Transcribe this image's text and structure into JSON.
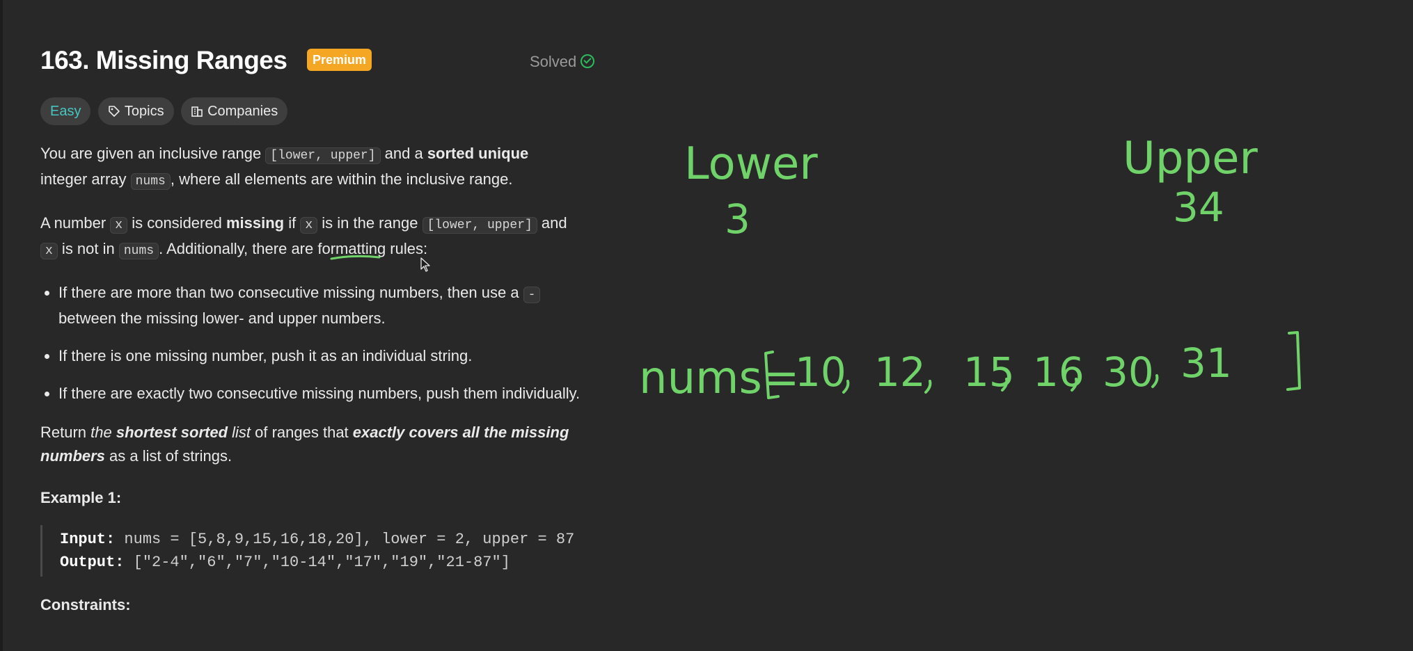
{
  "problem": {
    "title": "163. Missing Ranges",
    "premium_badge": "Premium",
    "status": "Solved",
    "tags": {
      "difficulty": "Easy",
      "topics": "Topics",
      "companies": "Companies"
    }
  },
  "description": {
    "p1": {
      "t1": "You are given an inclusive range ",
      "code1": "[lower, upper]",
      "t2": " and a ",
      "bold1": "sorted unique",
      "t3": " integer array ",
      "code2": "nums",
      "t4": ", where all elements are within the inclusive range."
    },
    "p2": {
      "t1": "A number ",
      "code1": "x",
      "t2": " is considered ",
      "bold1": "missing",
      "t3": " if ",
      "code2": "x",
      "t4": " is in the range ",
      "code3": "[lower, upper]",
      "t5": " and ",
      "code4": "x",
      "t6": " is not in ",
      "code5": "nums",
      "t7": ". Additionally, there are formatting rules:"
    },
    "rules": {
      "r1_text": "If there are more than two consecutive missing numbers, then use a ",
      "r1_code": "-",
      "r1_tail": " between the missing lower- and upper numbers.",
      "r2": "If there is one missing number, push it as an individual string.",
      "r3": "If there are exactly two consecutive missing numbers, push them individually."
    },
    "p3": {
      "t1": "Return ",
      "i1": "the ",
      "bi1": "shortest sorted",
      "t2": " list",
      "t3": " of ranges that ",
      "bi2": "exactly covers all the missing numbers",
      "t4": " as a list of strings."
    }
  },
  "example1": {
    "title": "Example 1:",
    "input_label": "Input:",
    "input_value": " nums = [5,8,9,15,16,18,20], lower = 2, upper = 87",
    "output_label": "Output:",
    "output_value": " [\"2-4\",\"6\",\"7\",\"10-14\",\"17\",\"19\",\"21-87\"]"
  },
  "constraints": {
    "title": "Constraints:"
  },
  "whiteboard": {
    "ink_color": "#6fd36a",
    "lower_label": "Lower",
    "lower_value": "3",
    "upper_label": "Upper",
    "upper_value": "34",
    "nums_label": "nums=",
    "nums_values": [
      "10",
      "12",
      "15",
      "16",
      "30",
      "31"
    ]
  },
  "colors": {
    "background": "#282828",
    "premium": "#f5a623",
    "easy": "#46c6c2",
    "solved_check": "#2cbb5d"
  }
}
